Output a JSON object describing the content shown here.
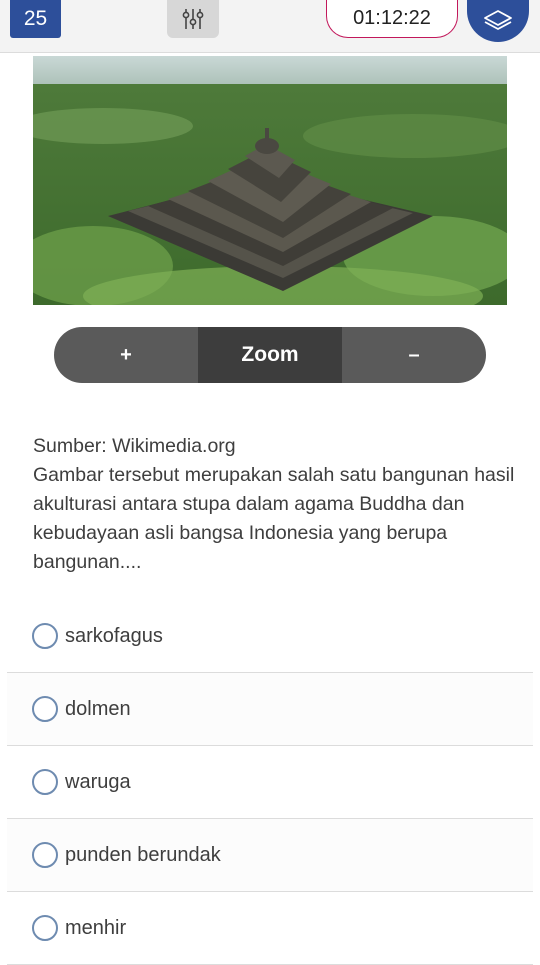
{
  "header": {
    "question_number": "25",
    "timer": "01:12:22",
    "settings_icon": "sliders-icon",
    "layers_icon": "layers-icon"
  },
  "image": {
    "subject": "borobudur-temple-photo"
  },
  "zoom": {
    "plus": "+",
    "label": "Zoom",
    "minus": "–"
  },
  "question": {
    "source": "Sumber: Wikimedia.org",
    "text": "Gambar tersebut merupakan salah satu bangunan hasil akulturasi antara stupa dalam agama Buddha dan kebudayaan asli bangsa Indonesia yang berupa bangunan...."
  },
  "options": [
    {
      "label": "sarkofagus"
    },
    {
      "label": "dolmen"
    },
    {
      "label": "waruga"
    },
    {
      "label": "punden berundak"
    },
    {
      "label": "menhir"
    }
  ],
  "colors": {
    "primary": "#2d4f9a",
    "timer_border": "#c2185b",
    "zoom_bg": "#5a5a5a"
  }
}
